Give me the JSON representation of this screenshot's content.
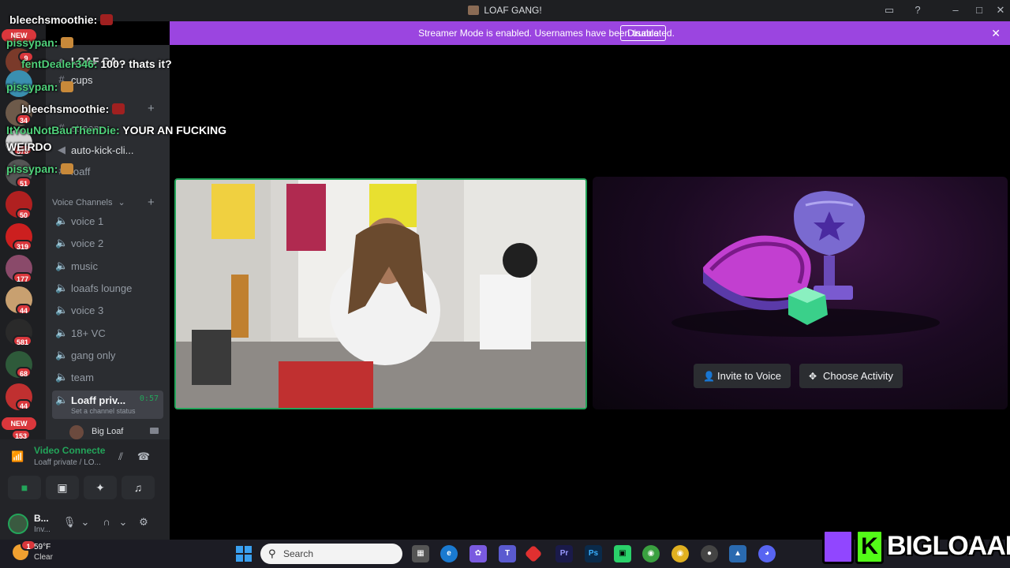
{
  "window": {
    "title": "LOAF GANG!"
  },
  "banner": {
    "message": "Streamer Mode is enabled. Usernames have been truncated.",
    "disable_label": "Disable"
  },
  "rail": {
    "new_top": "NEW",
    "new_bottom": "NEW",
    "badges": [
      "9",
      "34",
      "578",
      "51",
      "50",
      "319",
      "177",
      "44",
      "581",
      "68",
      "44",
      "153"
    ]
  },
  "sidebar": {
    "server_name": "LOAF GA...",
    "text_channels": [
      {
        "label": "cups"
      },
      {
        "label": "stream..."
      },
      {
        "label": "auto-kick-cli..."
      },
      {
        "label": "loaff"
      }
    ],
    "voice_section": "Voice Channels",
    "voice_channels": [
      {
        "label": "voice 1"
      },
      {
        "label": "voice 2"
      },
      {
        "label": "music"
      },
      {
        "label": "loaafs lounge"
      },
      {
        "label": "voice 3"
      },
      {
        "label": "18+ VC"
      },
      {
        "label": "gang only"
      },
      {
        "label": "team"
      }
    ],
    "active_channel": {
      "label": "Loaff priv...",
      "timer": "0:57",
      "status": "Set a channel status"
    },
    "voice_user": {
      "name": "Big Loaf"
    }
  },
  "voice_panel": {
    "title": "Video Connecte",
    "subtitle": "Loaff private / LO..."
  },
  "user_panel": {
    "name": "B...",
    "status": "Inv..."
  },
  "activity": {
    "invite_label": "Invite to Voice",
    "choose_label": "Choose Activity"
  },
  "chat": [
    {
      "user": "bleechsmoothie:",
      "msg": "",
      "color": "#f5f5f5"
    },
    {
      "user": "pissypan:",
      "msg": "",
      "color": "#4fd07a"
    },
    {
      "user": "fentDealer346:",
      "msg": "100? thats it?",
      "color": "#4fd07a"
    },
    {
      "user": "pissypan:",
      "msg": "",
      "color": "#4fd07a"
    },
    {
      "user": "bleechsmoothie:",
      "msg": "",
      "color": "#f5f5f5"
    },
    {
      "user": "ItYouNotBauThenDie:",
      "msg": "YOUR AN FUCKING",
      "color": "#4fd07a"
    },
    {
      "user": "",
      "msg": "WEIRDO",
      "color": "#ffffff"
    },
    {
      "user": "pissypan:",
      "msg": "",
      "color": "#4fd07a"
    }
  ],
  "taskbar": {
    "temp": "59°F",
    "condition": "Clear",
    "search_placeholder": "Search",
    "weather_badge": "1"
  },
  "brand": {
    "name": "BIGLOAAF",
    "kick_letter": "K"
  },
  "colors": {
    "accent_purple": "#9b45e0",
    "online_green": "#23a55a",
    "discord_dark": "#1e1f22"
  }
}
